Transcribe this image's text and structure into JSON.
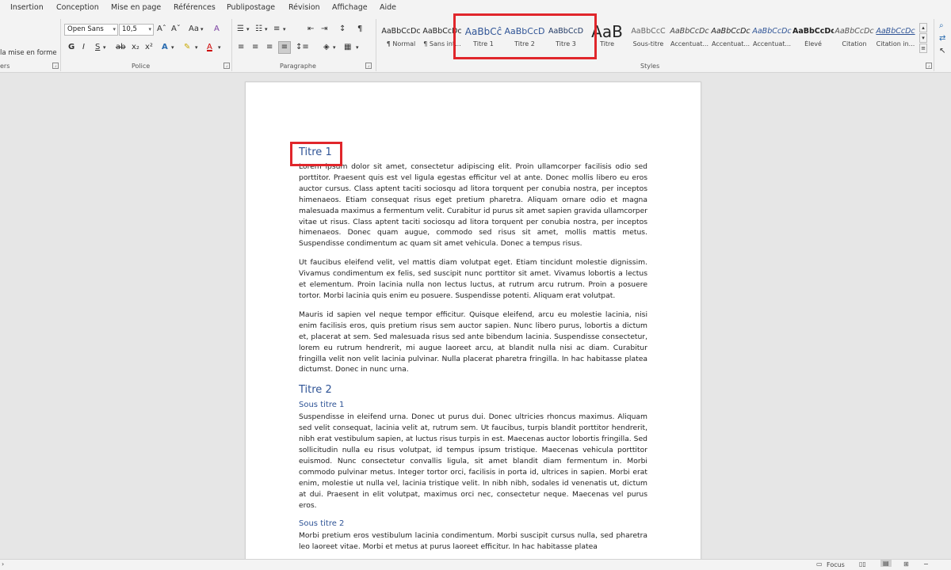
{
  "ribbon": {
    "tabs": [
      "Insertion",
      "Conception",
      "Mise en page",
      "Références",
      "Publipostage",
      "Révision",
      "Affichage",
      "Aide"
    ],
    "clipboard": {
      "format_painter_label": "la mise en forme"
    },
    "font": {
      "group_label": "Police",
      "font_name": "Open Sans",
      "font_size": "10,5",
      "grow": "Aˆ",
      "shrink": "Aˇ",
      "case": "Aa",
      "clear": "A",
      "bold": "G",
      "italic": "I",
      "underline": "S",
      "strike": "ab",
      "subscript": "x₂",
      "superscript": "x²",
      "text_effect": "A",
      "highlight": "✎",
      "font_color": "A"
    },
    "paragraph": {
      "group_label": "Paragraphe"
    },
    "styles": {
      "group_label": "Styles",
      "items": [
        {
          "sample": "AaBbCcDc",
          "name": "¶ Normal"
        },
        {
          "sample": "AaBbCcDc",
          "name": "¶ Sans int..."
        },
        {
          "sample": "AaBbCĉ",
          "name": "Titre 1"
        },
        {
          "sample": "AaBbCcD",
          "name": "Titre 2"
        },
        {
          "sample": "AaBbCcD",
          "name": "Titre 3"
        },
        {
          "sample": "AaB",
          "name": "Titre"
        },
        {
          "sample": "AaBbCcC",
          "name": "Sous-titre"
        },
        {
          "sample": "AaBbCcDc",
          "name": "Accentuat..."
        },
        {
          "sample": "AaBbCcDc",
          "name": "Accentuat..."
        },
        {
          "sample": "AaBbCcDc",
          "name": "Accentuat..."
        },
        {
          "sample": "AaBbCcDc",
          "name": "Élevé"
        },
        {
          "sample": "AaBbCcDc",
          "name": "Citation"
        },
        {
          "sample": "AaBbCcDc",
          "name": "Citation in..."
        }
      ]
    }
  },
  "document": {
    "heading1": "Titre 1",
    "para1": "Lorem ipsum dolor sit amet, consectetur adipiscing elit. Proin ullamcorper facilisis odio sed porttitor. Praesent quis est vel ligula egestas efficitur vel at ante. Donec mollis libero eu eros auctor cursus. Class aptent taciti sociosqu ad litora torquent per conubia nostra, per inceptos himenaeos. Etiam consequat risus eget pretium pharetra. Aliquam ornare odio et magna malesuada maximus a fermentum velit. Curabitur id purus sit amet sapien gravida ullamcorper vitae ut risus. Class aptent taciti sociosqu ad litora torquent per conubia nostra, per inceptos himenaeos. Donec quam augue, commodo sed risus sit amet, mollis mattis metus. Suspendisse condimentum ac quam sit amet vehicula. Donec a tempus risus.",
    "para2": "Ut faucibus eleifend velit, vel mattis diam volutpat eget. Etiam tincidunt molestie dignissim. Vivamus condimentum ex felis, sed suscipit nunc porttitor sit amet. Vivamus lobortis a lectus et elementum. Proin lacinia nulla non lectus luctus, at rutrum arcu rutrum. Proin a posuere tortor. Morbi lacinia quis enim eu posuere. Suspendisse potenti. Aliquam erat volutpat.",
    "para3": "Mauris id sapien vel neque tempor efficitur. Quisque eleifend, arcu eu molestie lacinia, nisi enim facilisis eros, quis pretium risus sem auctor sapien. Nunc libero purus, lobortis a dictum et, placerat at sem. Sed malesuada risus sed ante bibendum lacinia. Suspendisse consectetur, lorem eu rutrum hendrerit, mi augue laoreet arcu, at blandit nulla nisi ac diam. Curabitur fringilla velit non velit lacinia pulvinar. Nulla placerat pharetra fringilla. In hac habitasse platea dictumst. Donec in nunc urna.",
    "heading2": "Titre 2",
    "subheading1": "Sous titre 1",
    "para4": "Suspendisse in eleifend urna. Donec ut purus dui. Donec ultricies rhoncus maximus. Aliquam sed velit consequat, lacinia velit at, rutrum sem. Ut faucibus, turpis blandit porttitor hendrerit, nibh erat vestibulum sapien, at luctus risus turpis in est. Maecenas auctor lobortis fringilla. Sed sollicitudin nulla eu risus volutpat, id tempus ipsum tristique. Maecenas vehicula porttitor euismod. Nunc consectetur convallis ligula, sit amet blandit diam fermentum in. Morbi commodo pulvinar metus. Integer tortor orci, facilisis in porta id, ultrices in sapien. Morbi erat enim, molestie ut nulla vel, lacinia tristique velit. In nibh nibh, sodales id venenatis ut, dictum at dui. Praesent in elit volutpat, maximus orci nec, consectetur neque. Maecenas vel purus eros.",
    "subheading2": "Sous titre 2",
    "para5": "Morbi pretium eros vestibulum lacinia condimentum. Morbi suscipit cursus nulla, sed pharetra leo laoreet vitae. Morbi et metus at purus laoreet efficitur. In hac habitasse platea"
  },
  "statusbar": {
    "focus_label": "Focus"
  },
  "colors": {
    "accent": "#2f5496",
    "highlight_box": "#e0262b"
  }
}
